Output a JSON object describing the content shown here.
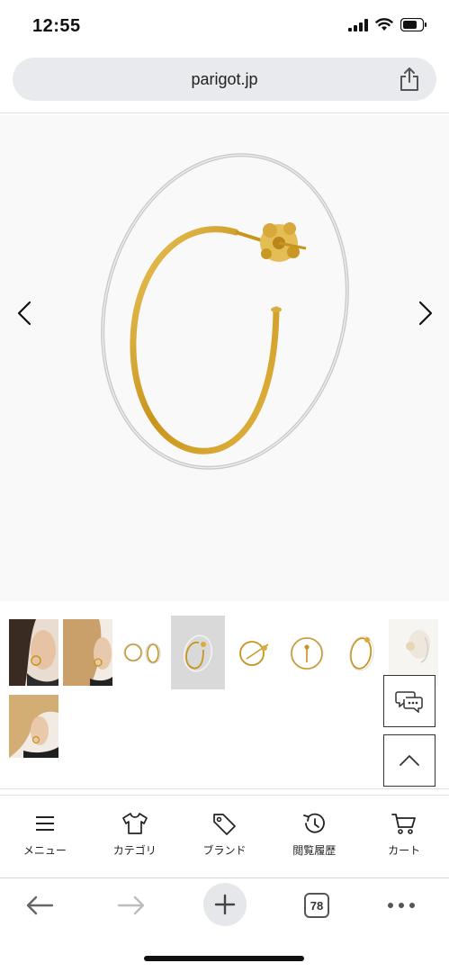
{
  "status": {
    "time": "12:55"
  },
  "browser": {
    "url": "parigot.jp",
    "tab_count": "78"
  },
  "product": {
    "image_icon": "gold-silver-hoop-earring"
  },
  "thumbnails": [
    {
      "icon": "model-wearing-earring-photo",
      "selected": false
    },
    {
      "icon": "model-blonde-side-photo",
      "selected": false
    },
    {
      "icon": "earring-pair-icon",
      "selected": false
    },
    {
      "icon": "hoop-earring-icon",
      "selected": true
    },
    {
      "icon": "earring-side-icon",
      "selected": false
    },
    {
      "icon": "earring-front-icon",
      "selected": false
    },
    {
      "icon": "earring-angle-icon",
      "selected": false
    },
    {
      "icon": "earring-back-icon",
      "selected": false
    },
    {
      "icon": "model-ear-photo",
      "selected": false
    }
  ],
  "site_nav": [
    {
      "label": "メニュー",
      "icon": "menu-icon"
    },
    {
      "label": "カテゴリ",
      "icon": "tshirt-icon"
    },
    {
      "label": "ブランド",
      "icon": "tag-icon"
    },
    {
      "label": "閲覧履歴",
      "icon": "history-icon"
    },
    {
      "label": "カート",
      "icon": "cart-icon"
    }
  ],
  "colors": {
    "gold": "#d4a62a",
    "silver": "#c9c9c9",
    "hero_bg": "#f9f9f9",
    "selected_thumb": "#d9d9d9"
  }
}
